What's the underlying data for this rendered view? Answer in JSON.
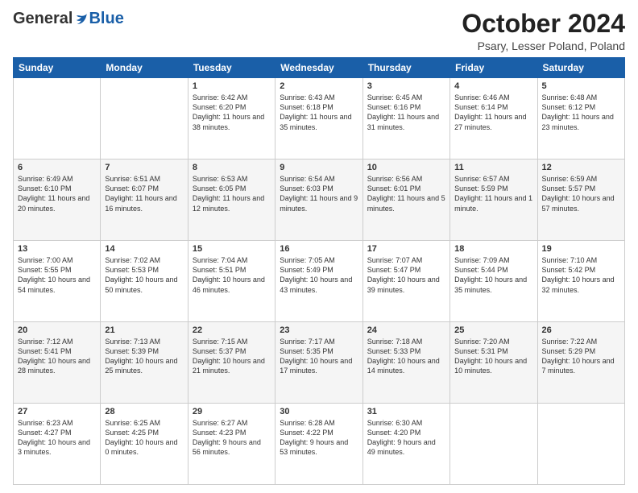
{
  "logo": {
    "general": "General",
    "blue": "Blue"
  },
  "header": {
    "month": "October 2024",
    "location": "Psary, Lesser Poland, Poland"
  },
  "days": [
    "Sunday",
    "Monday",
    "Tuesday",
    "Wednesday",
    "Thursday",
    "Friday",
    "Saturday"
  ],
  "weeks": [
    [
      {
        "day": "",
        "sunrise": "",
        "sunset": "",
        "daylight": ""
      },
      {
        "day": "",
        "sunrise": "",
        "sunset": "",
        "daylight": ""
      },
      {
        "day": "1",
        "sunrise": "Sunrise: 6:42 AM",
        "sunset": "Sunset: 6:20 PM",
        "daylight": "Daylight: 11 hours and 38 minutes."
      },
      {
        "day": "2",
        "sunrise": "Sunrise: 6:43 AM",
        "sunset": "Sunset: 6:18 PM",
        "daylight": "Daylight: 11 hours and 35 minutes."
      },
      {
        "day": "3",
        "sunrise": "Sunrise: 6:45 AM",
        "sunset": "Sunset: 6:16 PM",
        "daylight": "Daylight: 11 hours and 31 minutes."
      },
      {
        "day": "4",
        "sunrise": "Sunrise: 6:46 AM",
        "sunset": "Sunset: 6:14 PM",
        "daylight": "Daylight: 11 hours and 27 minutes."
      },
      {
        "day": "5",
        "sunrise": "Sunrise: 6:48 AM",
        "sunset": "Sunset: 6:12 PM",
        "daylight": "Daylight: 11 hours and 23 minutes."
      }
    ],
    [
      {
        "day": "6",
        "sunrise": "Sunrise: 6:49 AM",
        "sunset": "Sunset: 6:10 PM",
        "daylight": "Daylight: 11 hours and 20 minutes."
      },
      {
        "day": "7",
        "sunrise": "Sunrise: 6:51 AM",
        "sunset": "Sunset: 6:07 PM",
        "daylight": "Daylight: 11 hours and 16 minutes."
      },
      {
        "day": "8",
        "sunrise": "Sunrise: 6:53 AM",
        "sunset": "Sunset: 6:05 PM",
        "daylight": "Daylight: 11 hours and 12 minutes."
      },
      {
        "day": "9",
        "sunrise": "Sunrise: 6:54 AM",
        "sunset": "Sunset: 6:03 PM",
        "daylight": "Daylight: 11 hours and 9 minutes."
      },
      {
        "day": "10",
        "sunrise": "Sunrise: 6:56 AM",
        "sunset": "Sunset: 6:01 PM",
        "daylight": "Daylight: 11 hours and 5 minutes."
      },
      {
        "day": "11",
        "sunrise": "Sunrise: 6:57 AM",
        "sunset": "Sunset: 5:59 PM",
        "daylight": "Daylight: 11 hours and 1 minute."
      },
      {
        "day": "12",
        "sunrise": "Sunrise: 6:59 AM",
        "sunset": "Sunset: 5:57 PM",
        "daylight": "Daylight: 10 hours and 57 minutes."
      }
    ],
    [
      {
        "day": "13",
        "sunrise": "Sunrise: 7:00 AM",
        "sunset": "Sunset: 5:55 PM",
        "daylight": "Daylight: 10 hours and 54 minutes."
      },
      {
        "day": "14",
        "sunrise": "Sunrise: 7:02 AM",
        "sunset": "Sunset: 5:53 PM",
        "daylight": "Daylight: 10 hours and 50 minutes."
      },
      {
        "day": "15",
        "sunrise": "Sunrise: 7:04 AM",
        "sunset": "Sunset: 5:51 PM",
        "daylight": "Daylight: 10 hours and 46 minutes."
      },
      {
        "day": "16",
        "sunrise": "Sunrise: 7:05 AM",
        "sunset": "Sunset: 5:49 PM",
        "daylight": "Daylight: 10 hours and 43 minutes."
      },
      {
        "day": "17",
        "sunrise": "Sunrise: 7:07 AM",
        "sunset": "Sunset: 5:47 PM",
        "daylight": "Daylight: 10 hours and 39 minutes."
      },
      {
        "day": "18",
        "sunrise": "Sunrise: 7:09 AM",
        "sunset": "Sunset: 5:44 PM",
        "daylight": "Daylight: 10 hours and 35 minutes."
      },
      {
        "day": "19",
        "sunrise": "Sunrise: 7:10 AM",
        "sunset": "Sunset: 5:42 PM",
        "daylight": "Daylight: 10 hours and 32 minutes."
      }
    ],
    [
      {
        "day": "20",
        "sunrise": "Sunrise: 7:12 AM",
        "sunset": "Sunset: 5:41 PM",
        "daylight": "Daylight: 10 hours and 28 minutes."
      },
      {
        "day": "21",
        "sunrise": "Sunrise: 7:13 AM",
        "sunset": "Sunset: 5:39 PM",
        "daylight": "Daylight: 10 hours and 25 minutes."
      },
      {
        "day": "22",
        "sunrise": "Sunrise: 7:15 AM",
        "sunset": "Sunset: 5:37 PM",
        "daylight": "Daylight: 10 hours and 21 minutes."
      },
      {
        "day": "23",
        "sunrise": "Sunrise: 7:17 AM",
        "sunset": "Sunset: 5:35 PM",
        "daylight": "Daylight: 10 hours and 17 minutes."
      },
      {
        "day": "24",
        "sunrise": "Sunrise: 7:18 AM",
        "sunset": "Sunset: 5:33 PM",
        "daylight": "Daylight: 10 hours and 14 minutes."
      },
      {
        "day": "25",
        "sunrise": "Sunrise: 7:20 AM",
        "sunset": "Sunset: 5:31 PM",
        "daylight": "Daylight: 10 hours and 10 minutes."
      },
      {
        "day": "26",
        "sunrise": "Sunrise: 7:22 AM",
        "sunset": "Sunset: 5:29 PM",
        "daylight": "Daylight: 10 hours and 7 minutes."
      }
    ],
    [
      {
        "day": "27",
        "sunrise": "Sunrise: 6:23 AM",
        "sunset": "Sunset: 4:27 PM",
        "daylight": "Daylight: 10 hours and 3 minutes."
      },
      {
        "day": "28",
        "sunrise": "Sunrise: 6:25 AM",
        "sunset": "Sunset: 4:25 PM",
        "daylight": "Daylight: 10 hours and 0 minutes."
      },
      {
        "day": "29",
        "sunrise": "Sunrise: 6:27 AM",
        "sunset": "Sunset: 4:23 PM",
        "daylight": "Daylight: 9 hours and 56 minutes."
      },
      {
        "day": "30",
        "sunrise": "Sunrise: 6:28 AM",
        "sunset": "Sunset: 4:22 PM",
        "daylight": "Daylight: 9 hours and 53 minutes."
      },
      {
        "day": "31",
        "sunrise": "Sunrise: 6:30 AM",
        "sunset": "Sunset: 4:20 PM",
        "daylight": "Daylight: 9 hours and 49 minutes."
      },
      {
        "day": "",
        "sunrise": "",
        "sunset": "",
        "daylight": ""
      },
      {
        "day": "",
        "sunrise": "",
        "sunset": "",
        "daylight": ""
      }
    ]
  ]
}
